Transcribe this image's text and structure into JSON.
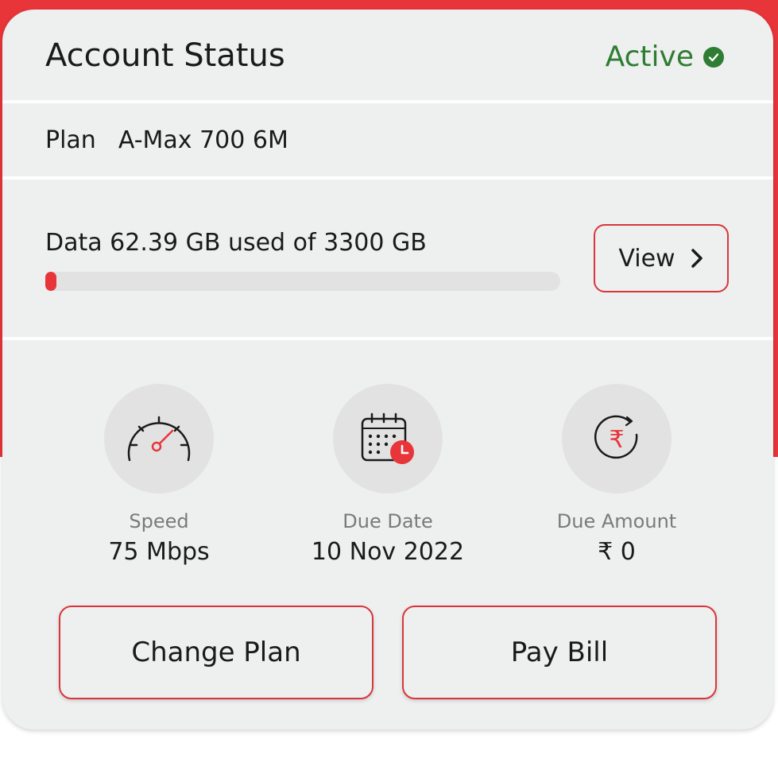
{
  "colors": {
    "accent": "#e8353a",
    "active": "#2e7d32",
    "card": "#eeefef"
  },
  "header": {
    "title": "Account Status",
    "status": "Active",
    "status_icon": "check-circle-icon"
  },
  "plan": {
    "label": "Plan",
    "name": "A-Max 700 6M"
  },
  "data": {
    "label": "Data 62.39 GB used of 3300 GB",
    "used_gb": 62.39,
    "total_gb": 3300,
    "view_label": "View"
  },
  "stats": [
    {
      "icon": "speedometer-icon",
      "label": "Speed",
      "value": "75 Mbps"
    },
    {
      "icon": "calendar-clock-icon",
      "label": "Due Date",
      "value": "10 Nov 2022"
    },
    {
      "icon": "rupee-cycle-icon",
      "label": "Due Amount",
      "value": "₹ 0"
    }
  ],
  "actions": {
    "change_plan": "Change Plan",
    "pay_bill": "Pay Bill"
  }
}
